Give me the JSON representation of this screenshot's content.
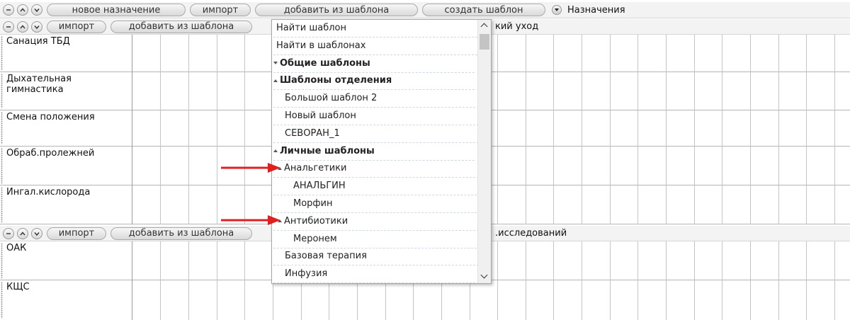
{
  "top_toolbar": {
    "new_assignment": "новое назначение",
    "import": "импорт",
    "add_from_template": "добавить из шаблона",
    "create_template": "создать шаблон",
    "title": "Назначения"
  },
  "section1": {
    "import": "импорт",
    "add_from_template": "добавить из шаблона",
    "title_visible": "кий уход",
    "rows": [
      "Санация ТБД",
      "Дыхательная гимнастика",
      "Смена положения",
      "Обраб.пролежней",
      "Ингал.кислорода"
    ]
  },
  "section2": {
    "import": "импорт",
    "add_from_template": "добавить из шаблона",
    "title_visible": "исследований",
    "rows": [
      "ОАК",
      "КЩС"
    ]
  },
  "popup": {
    "items": [
      {
        "label": "Найти шаблон",
        "bold": false,
        "indent": 0,
        "tri": ""
      },
      {
        "label": "Найти в шаблонах",
        "bold": false,
        "indent": 0,
        "tri": ""
      },
      {
        "label": "Общие шаблоны",
        "bold": true,
        "indent": 0,
        "tri": "down"
      },
      {
        "label": "Шаблоны отделения",
        "bold": true,
        "indent": 0,
        "tri": "up"
      },
      {
        "label": "Большой шаблон 2",
        "bold": false,
        "indent": 1,
        "tri": ""
      },
      {
        "label": "Новый шаблон",
        "bold": false,
        "indent": 1,
        "tri": ""
      },
      {
        "label": "СЕВОРАН_1",
        "bold": false,
        "indent": 1,
        "tri": ""
      },
      {
        "label": "Личные шаблоны",
        "bold": true,
        "indent": 0,
        "tri": "up"
      },
      {
        "label": "Анальгетики",
        "bold": false,
        "indent": 1,
        "tri": "up"
      },
      {
        "label": "АНАЛЬГИН",
        "bold": false,
        "indent": 2,
        "tri": ""
      },
      {
        "label": "Морфин",
        "bold": false,
        "indent": 2,
        "tri": ""
      },
      {
        "label": "Антибиотики",
        "bold": false,
        "indent": 1,
        "tri": "up"
      },
      {
        "label": "Меронем",
        "bold": false,
        "indent": 2,
        "tri": ""
      },
      {
        "label": "Базовая терапия",
        "bold": false,
        "indent": 1,
        "tri": ""
      },
      {
        "label": "Инфузия",
        "bold": false,
        "indent": 1,
        "tri": ""
      }
    ]
  },
  "colors": {
    "annotation_arrow": "#e02020"
  }
}
